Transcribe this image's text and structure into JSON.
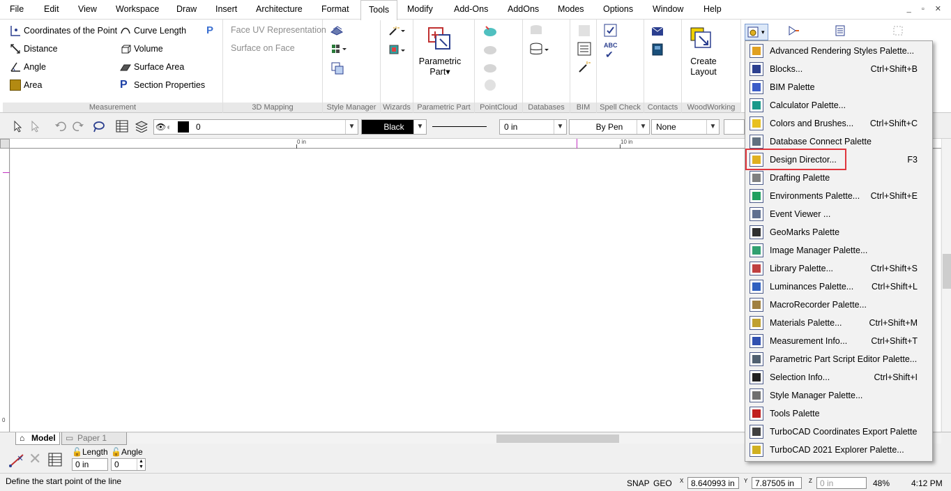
{
  "menubar": {
    "items": [
      "File",
      "Edit",
      "View",
      "Workspace",
      "Draw",
      "Insert",
      "Architecture",
      "Format",
      "Tools",
      "Modify",
      "Add-Ons",
      "AddOns",
      "Modes",
      "Options",
      "Window",
      "Help"
    ],
    "active": "Tools"
  },
  "ribbon": {
    "measurement": {
      "label": "Measurement",
      "coordinates": "Coordinates of the Point",
      "distance": "Distance",
      "angle": "Angle",
      "area": "Area",
      "curve_length": "Curve Length",
      "volume": "Volume",
      "surface_area": "Surface Area",
      "section_properties": "Section Properties"
    },
    "mapping": {
      "label": "3D Mapping",
      "face_uv": "Face UV Representation",
      "surface_on_face": "Surface on Face"
    },
    "style_manager": {
      "label": "Style Manager"
    },
    "wizards": {
      "label": "Wizards"
    },
    "parametric_part": {
      "label": "Parametric Part",
      "button_line1": "Parametric",
      "button_line2": "Part▾"
    },
    "pointcloud": {
      "label": "PointCloud"
    },
    "databases": {
      "label": "Databases"
    },
    "bim": {
      "label": "BIM"
    },
    "spell_check": {
      "label": "Spell Check",
      "abc": "ABC"
    },
    "contacts": {
      "label": "Contacts"
    },
    "woodworking": {
      "label": "WoodWorking",
      "create_line1": "Create",
      "create_line2": "Layout"
    }
  },
  "toolbar": {
    "layer_value": "0",
    "color_value": "Black",
    "width_value": "0 in",
    "pen_value": "By Pen",
    "hatch_value": "None"
  },
  "ruler": {
    "mark_0": "0 in",
    "mark_10": "10 in",
    "left_mark": "0"
  },
  "tabs": {
    "model": "Model",
    "paper": "Paper 1"
  },
  "inspector": {
    "length_label": "Length",
    "length_value": "0 in",
    "angle_label": "Angle",
    "angle_value": "0"
  },
  "statusbar": {
    "message": "Define the start point of the line",
    "snap": "SNAP",
    "geo": "GEO",
    "x_label": "X",
    "x_value": "8.640993 in",
    "y_label": "Y",
    "y_value": "7.87505 in",
    "z_label": "Z",
    "z_value": "0 in",
    "zoom": "48%",
    "time": "4:12 PM"
  },
  "dropdown": {
    "items": [
      {
        "label": "Advanced Rendering Styles Palette...",
        "shortcut": "",
        "icon": "rendering-styles-icon",
        "color": "#e0a020"
      },
      {
        "label": "Blocks...",
        "shortcut": "Ctrl+Shift+B",
        "icon": "blocks-icon",
        "color": "#2b3f8f"
      },
      {
        "label": "BIM Palette",
        "shortcut": "",
        "icon": "bim-icon",
        "color": "#3a5cc8"
      },
      {
        "label": "Calculator Palette...",
        "shortcut": "",
        "icon": "calculator-icon",
        "color": "#1a9a8a"
      },
      {
        "label": "Colors and Brushes...",
        "shortcut": "Ctrl+Shift+C",
        "icon": "colors-brushes-icon",
        "color": "#e8c020"
      },
      {
        "label": "Database Connect Palette",
        "shortcut": "",
        "icon": "database-icon",
        "color": "#607080"
      },
      {
        "label": "Design Director...",
        "shortcut": "F3",
        "icon": "design-director-icon",
        "color": "#e0b020"
      },
      {
        "label": "Drafting Palette",
        "shortcut": "",
        "icon": "drafting-icon",
        "color": "#808080"
      },
      {
        "label": "Environments Palette...",
        "shortcut": "Ctrl+Shift+E",
        "icon": "environments-icon",
        "color": "#20a060"
      },
      {
        "label": "Event Viewer ...",
        "shortcut": "",
        "icon": "event-viewer-icon",
        "color": "#607090"
      },
      {
        "label": "GeoMarks Palette",
        "shortcut": "",
        "icon": "geomarks-icon",
        "color": "#303030"
      },
      {
        "label": "Image Manager Palette...",
        "shortcut": "",
        "icon": "image-manager-icon",
        "color": "#30a070"
      },
      {
        "label": "Library Palette...",
        "shortcut": "Ctrl+Shift+S",
        "icon": "library-icon",
        "color": "#c04040"
      },
      {
        "label": "Luminances Palette...",
        "shortcut": "Ctrl+Shift+L",
        "icon": "luminances-icon",
        "color": "#3060c0"
      },
      {
        "label": "MacroRecorder Palette...",
        "shortcut": "",
        "icon": "macro-recorder-icon",
        "color": "#a08040"
      },
      {
        "label": "Materials Palette...",
        "shortcut": "Ctrl+Shift+M",
        "icon": "materials-icon",
        "color": "#c0a030"
      },
      {
        "label": "Measurement Info...",
        "shortcut": "Ctrl+Shift+T",
        "icon": "measurement-info-icon",
        "color": "#3050b0"
      },
      {
        "label": "Parametric Part Script Editor Palette...",
        "shortcut": "",
        "icon": "script-editor-icon",
        "color": "#506070"
      },
      {
        "label": "Selection Info...",
        "shortcut": "Ctrl+Shift+I",
        "icon": "selection-info-icon",
        "color": "#202020"
      },
      {
        "label": "Style Manager Palette...",
        "shortcut": "",
        "icon": "style-manager-icon",
        "color": "#707070"
      },
      {
        "label": "Tools Palette",
        "shortcut": "",
        "icon": "tools-palette-icon",
        "color": "#c02020"
      },
      {
        "label": "TurboCAD Coordinates Export Palette",
        "shortcut": "",
        "icon": "coords-export-icon",
        "color": "#404040"
      },
      {
        "label": "TurboCAD 2021 Explorer Palette...",
        "shortcut": "",
        "icon": "explorer-icon",
        "color": "#d0b020"
      }
    ]
  }
}
